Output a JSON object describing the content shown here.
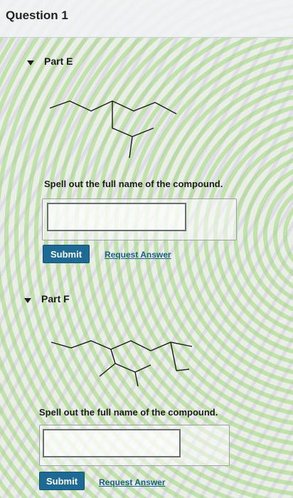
{
  "header": {
    "title": "Question 1"
  },
  "parts": [
    {
      "label": "Part E",
      "prompt": "Spell out the full name of the compound.",
      "answer": {
        "value": "",
        "placeholder": ""
      },
      "submit_label": "Submit",
      "request_label": "Request Answer"
    },
    {
      "label": "Part F",
      "prompt": "Spell out the full name of the compound.",
      "answer": {
        "value": "",
        "placeholder": ""
      },
      "submit_label": "Submit",
      "request_label": "Request Answer"
    }
  ],
  "colors": {
    "submit_bg": "#1d6a95",
    "link": "#1a5e8a"
  }
}
